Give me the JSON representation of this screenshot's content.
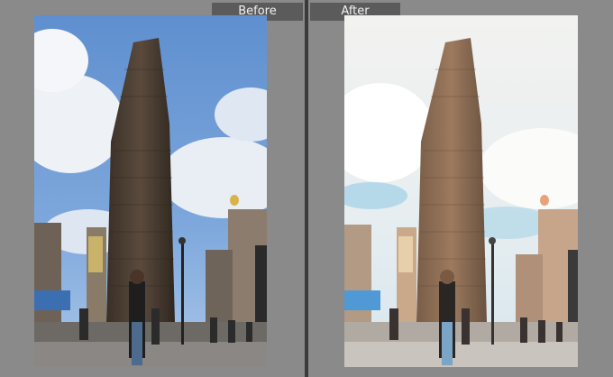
{
  "compare": {
    "before_label": "Before",
    "after_label": "After"
  },
  "colors": {
    "background": "#8a8a8a",
    "divider": "#3a3a3a",
    "label_bg": "#5b5b5b",
    "label_text": "#f2f2f2"
  },
  "photos": {
    "before": {
      "subject": "flatiron-building-street-scene",
      "tone": "original"
    },
    "after": {
      "subject": "flatiron-building-street-scene",
      "tone": "edited-warm-bright"
    }
  }
}
